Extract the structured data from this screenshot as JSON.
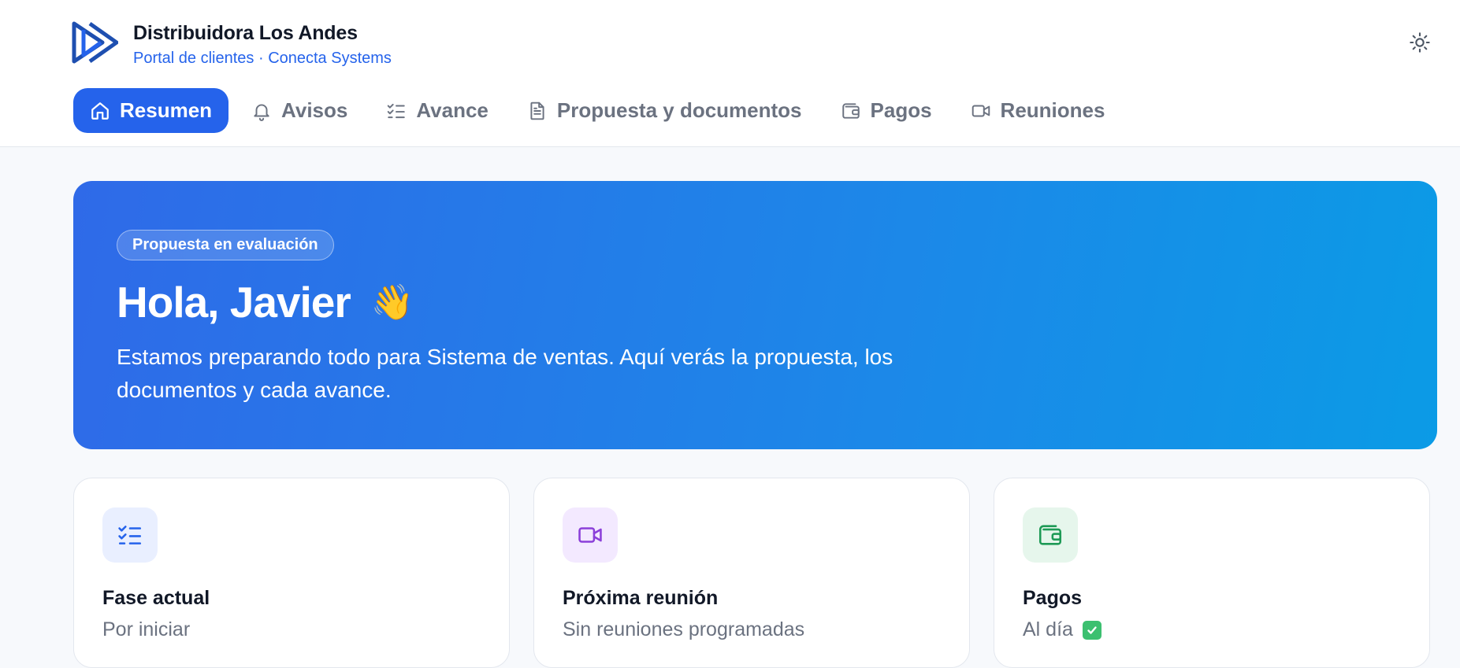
{
  "header": {
    "company": "Distribuidora Los Andes",
    "subtitle": "Portal de clientes · Conecta Systems",
    "logo_icon": "play-logo-icon",
    "theme_icon": "sun-icon"
  },
  "nav": {
    "items": [
      {
        "label": "Resumen",
        "icon": "home-icon",
        "active": true
      },
      {
        "label": "Avisos",
        "icon": "bell-icon"
      },
      {
        "label": "Avance",
        "icon": "checklist-icon"
      },
      {
        "label": "Propuesta y documentos",
        "icon": "document-icon"
      },
      {
        "label": "Pagos",
        "icon": "wallet-icon"
      },
      {
        "label": "Reuniones",
        "icon": "video-icon"
      }
    ]
  },
  "hero": {
    "badge": "Propuesta en evaluación",
    "greeting": "Hola, Javier",
    "emoji": "👋",
    "description": "Estamos preparando todo para Sistema de ventas. Aquí verás la propuesta, los documentos y cada avance."
  },
  "cards": [
    {
      "title": "Fase actual",
      "value": "Por iniciar",
      "icon": "checklist-icon",
      "icon_bg": "#e9efff",
      "icon_color": "#2563eb"
    },
    {
      "title": "Próxima reunión",
      "value": "Sin reuniones programadas",
      "icon": "video-icon",
      "icon_bg": "#f3e9ff",
      "icon_color": "#8b3fd9"
    },
    {
      "title": "Pagos",
      "value": "Al día",
      "icon": "wallet-icon",
      "icon_bg": "#e6f6ec",
      "icon_color": "#1e9a56",
      "status_icon": "check-box-icon"
    }
  ],
  "colors": {
    "primary": "#2563eb",
    "hero_start": "#2f6ae8",
    "hero_end": "#0b9be6",
    "success": "#3cc070"
  }
}
